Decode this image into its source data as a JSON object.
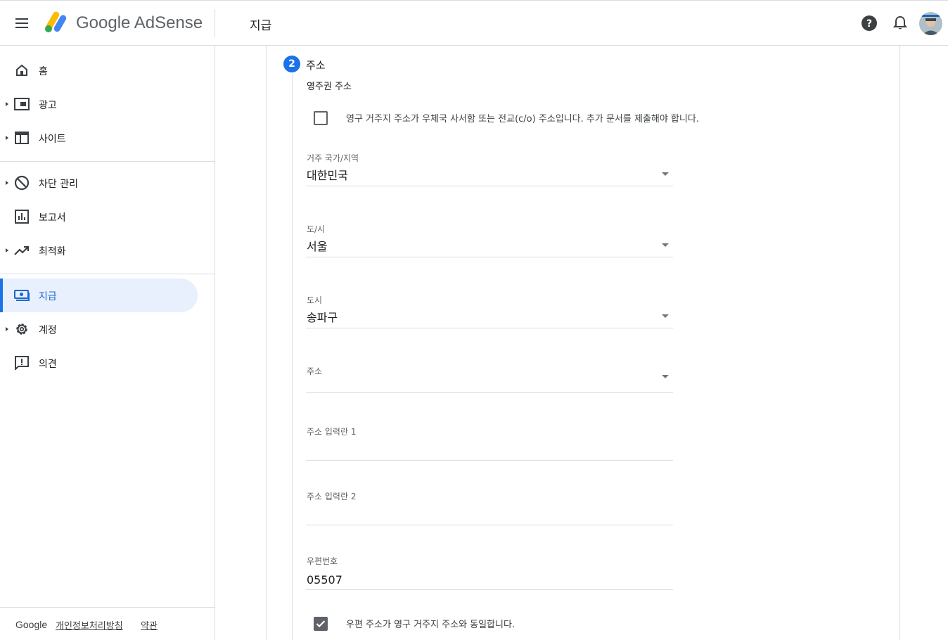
{
  "header": {
    "brand": "Google AdSense",
    "page_title": "지급"
  },
  "sidebar": {
    "items": [
      {
        "label": "홈"
      },
      {
        "label": "광고"
      },
      {
        "label": "사이트"
      },
      {
        "label": "차단 관리"
      },
      {
        "label": "보고서"
      },
      {
        "label": "최적화"
      },
      {
        "label": "지급"
      },
      {
        "label": "계정"
      },
      {
        "label": "의견"
      }
    ],
    "footer": {
      "google": "Google",
      "privacy": "개인정보처리방침",
      "terms": "약관"
    }
  },
  "form": {
    "step_number": "2",
    "step_title": "주소",
    "section_title": "영주권 주소",
    "po_box_checkbox_label": "영구 거주지 주소가 우체국 사서함 또는 전교(c/o) 주소입니다. 추가 문서를 제출해야 합니다.",
    "fields": {
      "country": {
        "label": "거주 국가/지역",
        "value": "대한민국"
      },
      "province": {
        "label": "도/시",
        "value": "서울"
      },
      "city": {
        "label": "도시",
        "value": "송파구"
      },
      "address": {
        "label": "주소",
        "value": ""
      },
      "address_line1": {
        "label": "주소 입력란 1",
        "value": ""
      },
      "address_line2": {
        "label": "주소 입력란 2",
        "value": ""
      },
      "postal_code": {
        "label": "우편번호",
        "value": "05507"
      }
    },
    "same_address_checkbox_label": "우편 주소가 영구 거주지 주소와 동일합니다."
  },
  "colors": {
    "accent": "#1a73e8",
    "active_nav_bg": "#e8f0fe",
    "divider": "#dadce0"
  }
}
